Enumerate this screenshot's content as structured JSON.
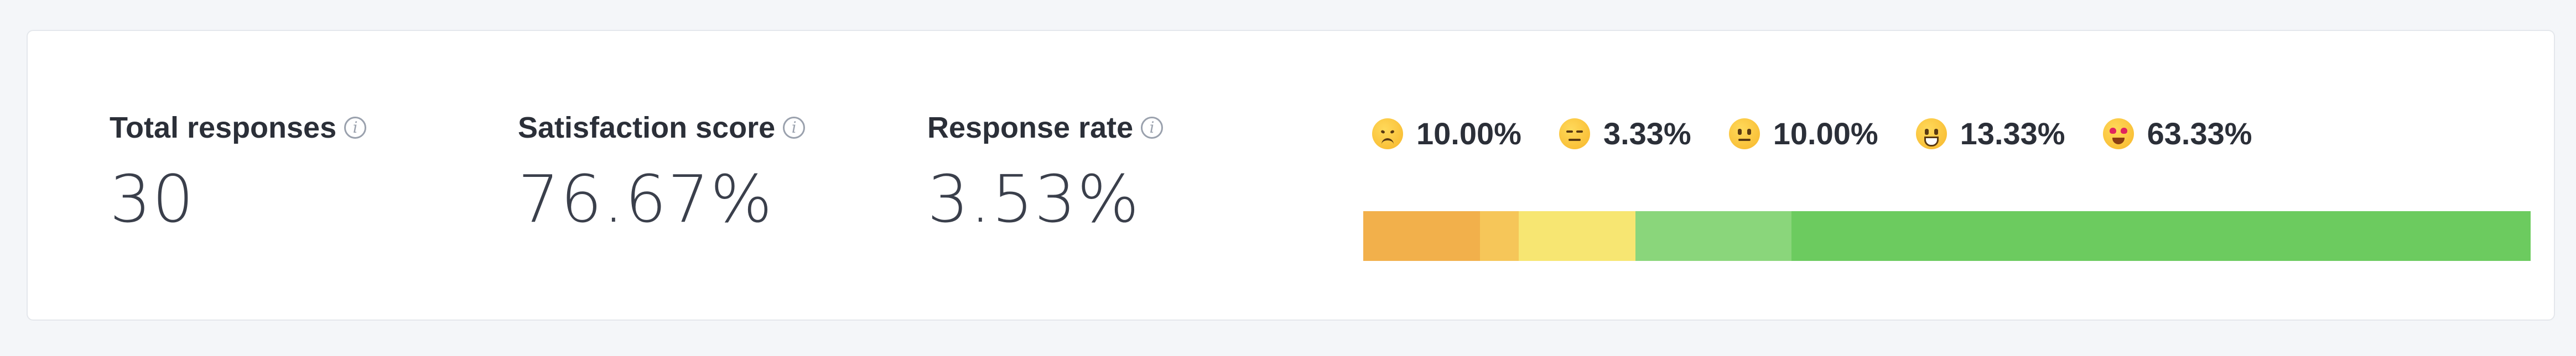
{
  "metrics": [
    {
      "label": "Total responses",
      "value": "30",
      "info_icon": "info-icon"
    },
    {
      "label": "Satisfaction score",
      "value": "76.67%",
      "info_icon": "info-icon"
    },
    {
      "label": "Response rate",
      "value": "3.53%",
      "info_icon": "info-icon"
    }
  ],
  "distribution": {
    "legend": [
      {
        "emoji": "disappointed-face",
        "percent": "10.00%",
        "fraction": 0.1
      },
      {
        "emoji": "expressionless-face",
        "percent": "3.33%",
        "fraction": 0.0333
      },
      {
        "emoji": "neutral-face",
        "percent": "10.00%",
        "fraction": 0.1
      },
      {
        "emoji": "grinning-face",
        "percent": "13.33%",
        "fraction": 0.1333
      },
      {
        "emoji": "heart-eyes-face",
        "percent": "63.33%",
        "fraction": 0.6333
      }
    ],
    "segment_colors": [
      "#f2b04b",
      "#f6c659",
      "#f7e672",
      "#8ad67b",
      "#6ccb5f"
    ]
  }
}
